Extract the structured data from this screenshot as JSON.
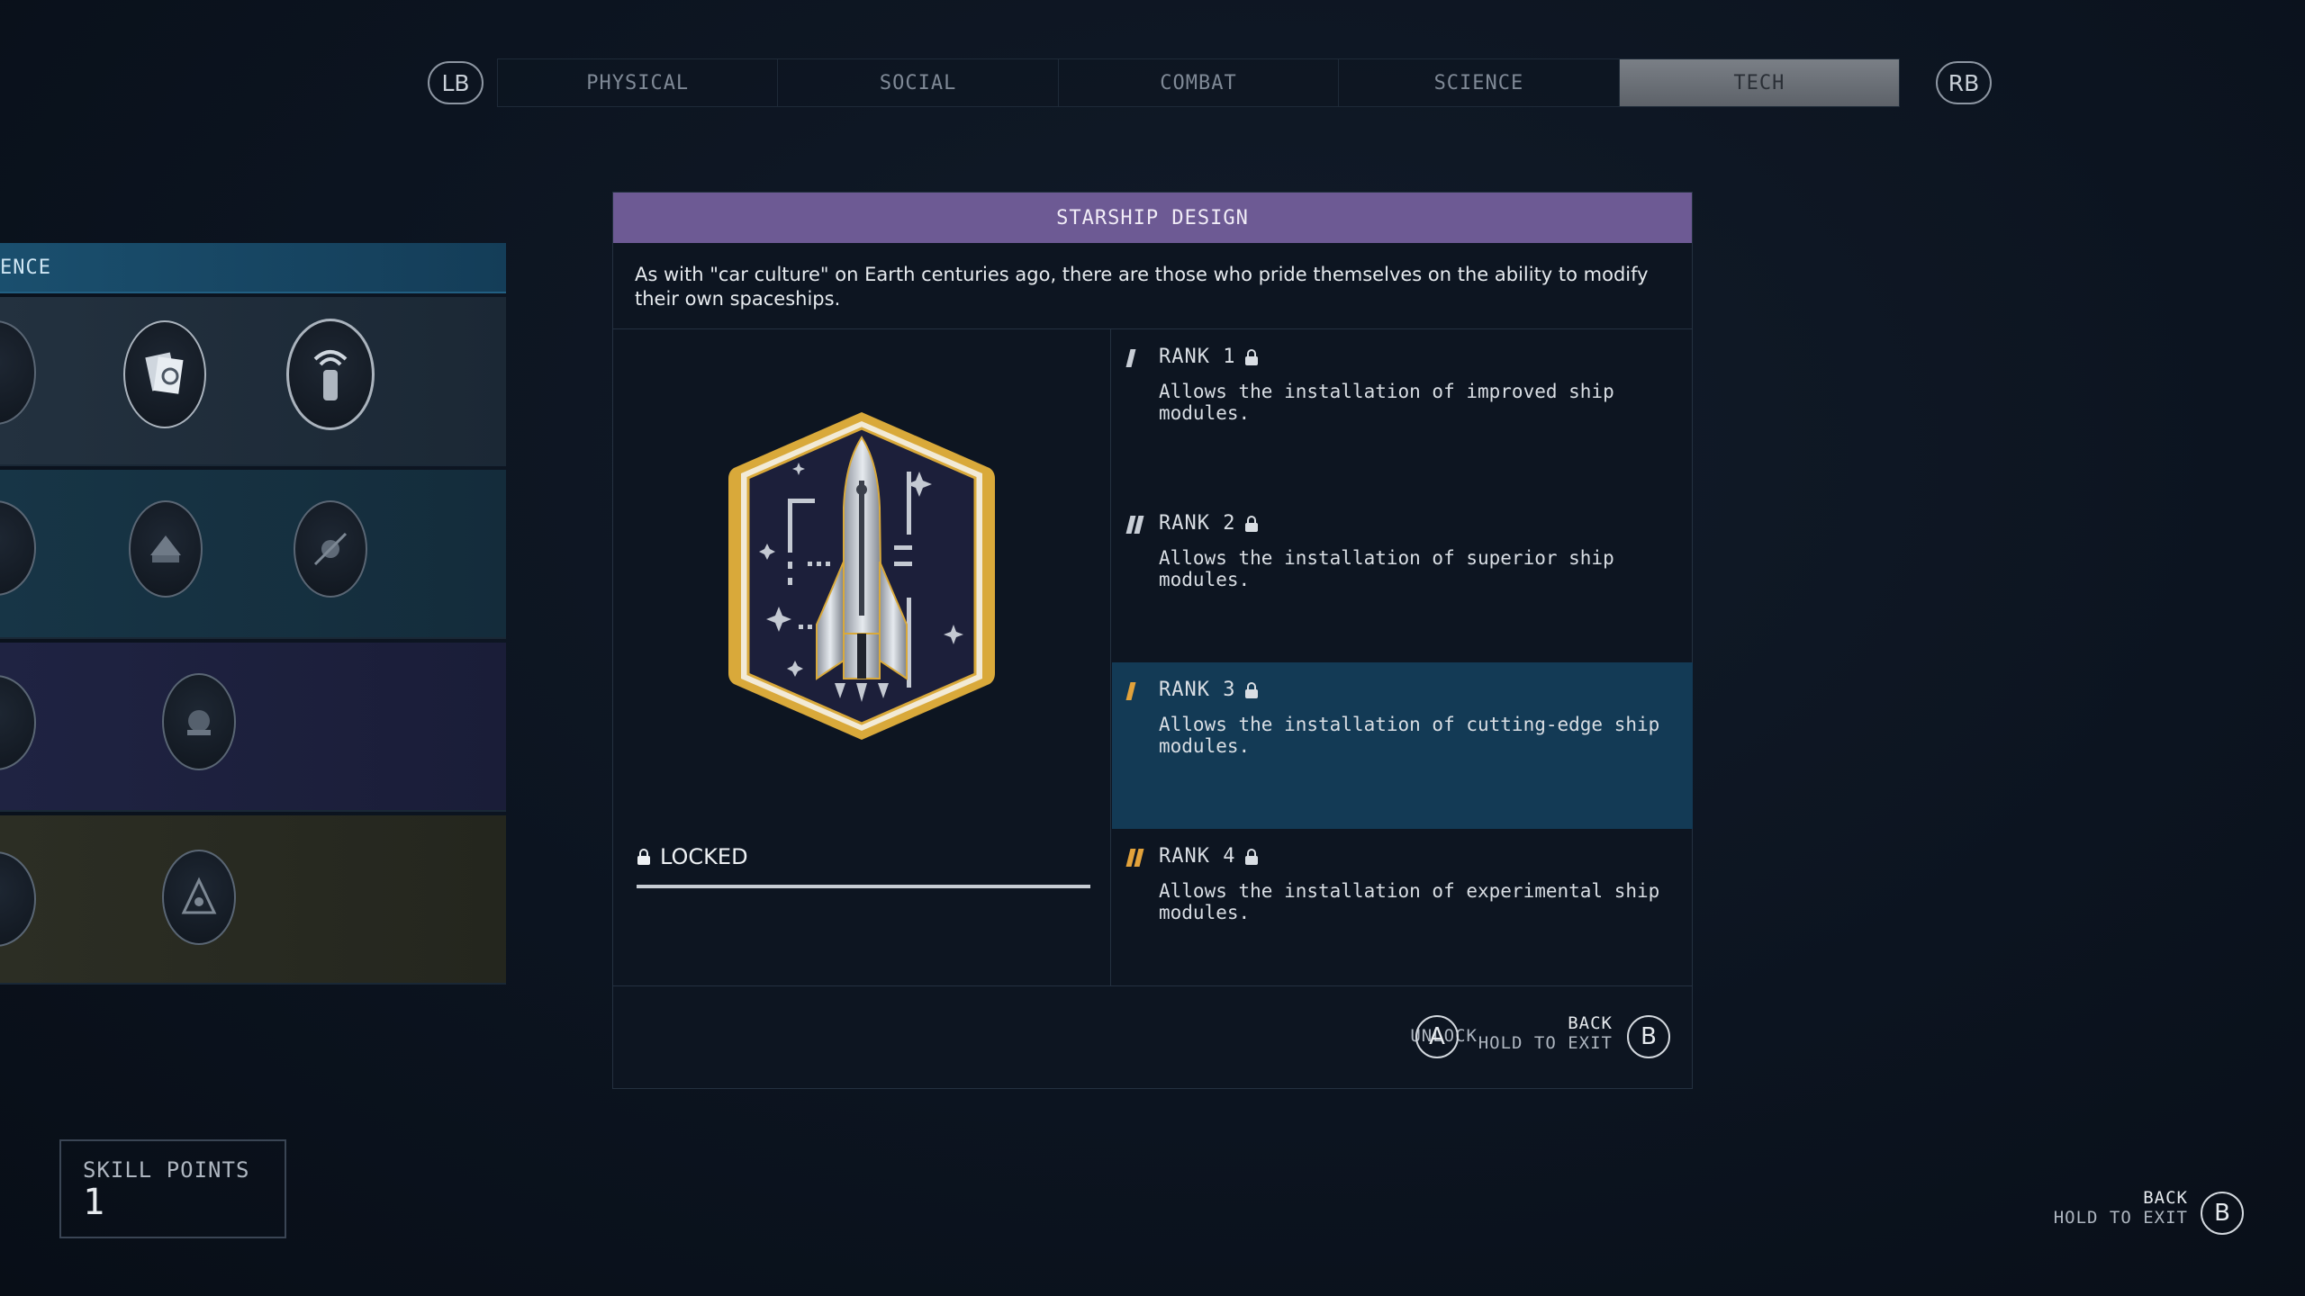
{
  "tabs": {
    "left_bumper": "LB",
    "right_bumper": "RB",
    "items": [
      {
        "label": "PHYSICAL"
      },
      {
        "label": "SOCIAL"
      },
      {
        "label": "COMBAT"
      },
      {
        "label": "SCIENCE"
      },
      {
        "label": "TECH"
      }
    ],
    "active_index": 4
  },
  "tree": {
    "header_label": "ENCE"
  },
  "panel": {
    "title": "STARSHIP DESIGN",
    "description": "As with \"car culture\" on Earth centuries ago, there are those who pride themselves on the ability to modify their own spaceships.",
    "status": "LOCKED",
    "ranks": [
      {
        "label": "RANK 1",
        "desc": "Allows the installation of improved ship modules."
      },
      {
        "label": "RANK 2",
        "desc": "Allows the installation of superior ship modules."
      },
      {
        "label": "RANK 3",
        "desc": "Allows the installation of cutting-edge ship modules."
      },
      {
        "label": "RANK 4",
        "desc": "Allows the installation of experimental ship modules."
      }
    ],
    "footer": {
      "unlock_label": "UNLOCK",
      "unlock_button": "A",
      "back_label": "BACK",
      "hold_label": "HOLD TO EXIT",
      "back_button": "B"
    }
  },
  "skill_points": {
    "label": "SKILL POINTS",
    "value": "1"
  },
  "global_back": {
    "back_label": "BACK",
    "hold_label": "HOLD TO EXIT",
    "button": "B"
  },
  "colors": {
    "title_bar": "#6d5a94",
    "highlight_rank": "#133a55",
    "gold": "#e2a23b",
    "tab_active": "#6a6f76"
  }
}
